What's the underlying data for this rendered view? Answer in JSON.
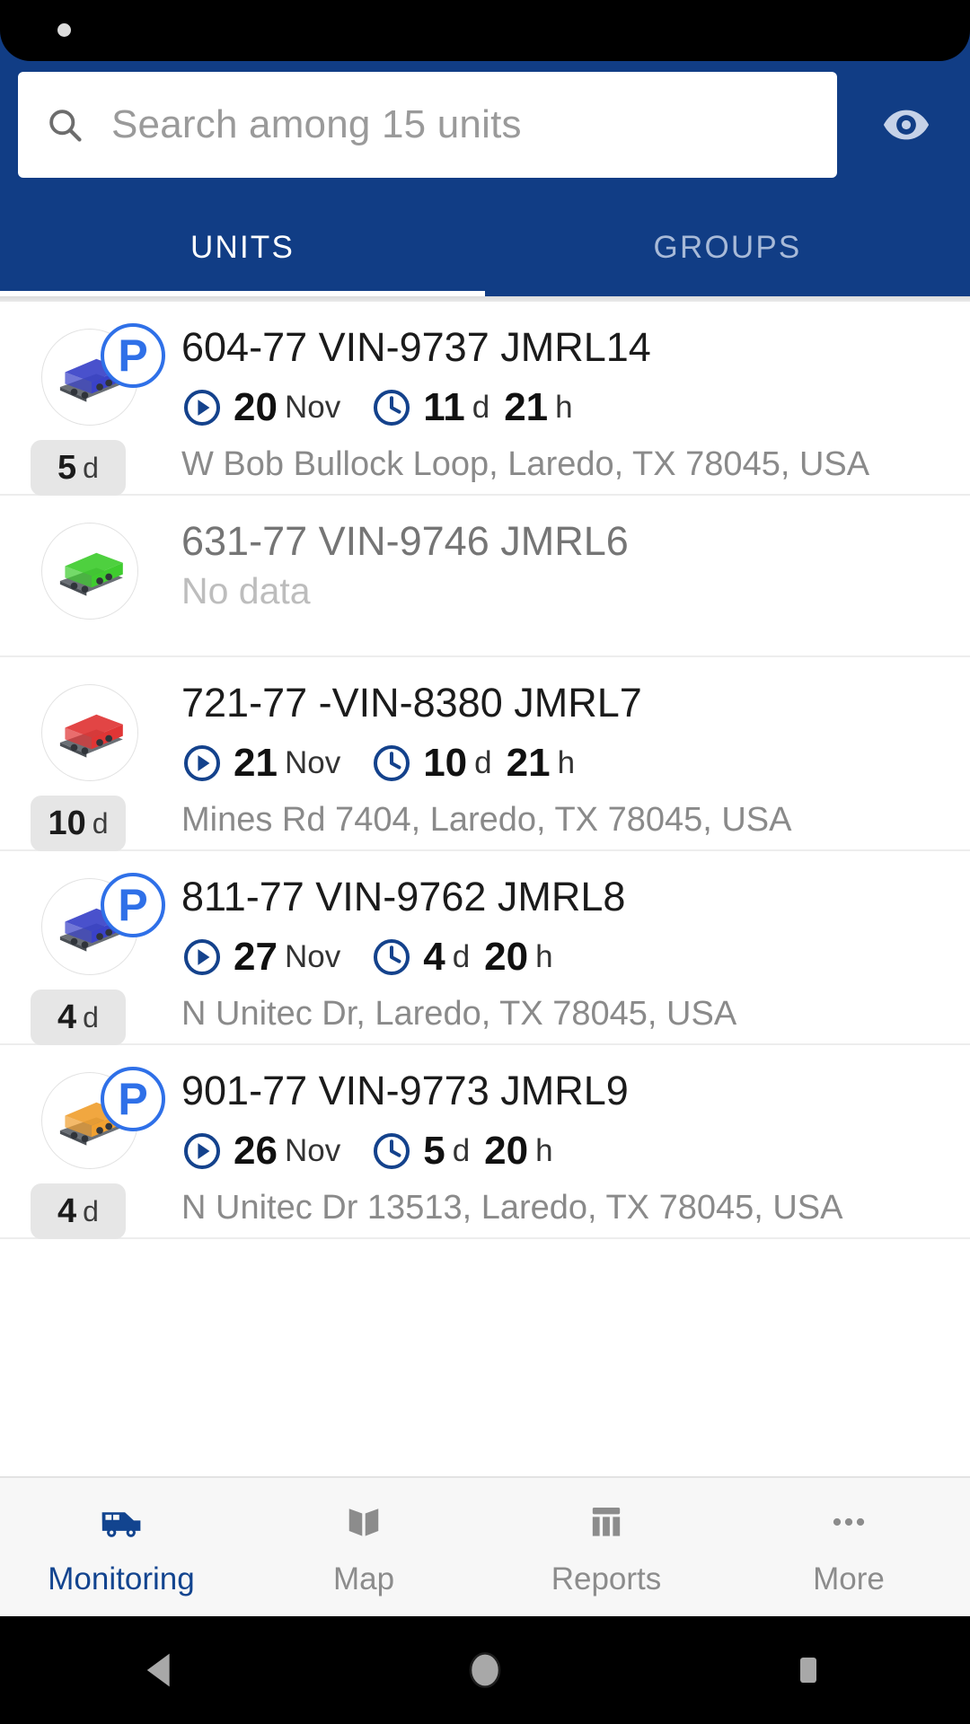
{
  "app": {
    "accent_blue": "#113d85",
    "badge_blue": "#2f70e8",
    "icon_blue": "#14428c"
  },
  "search": {
    "placeholder": "Search among 15 units",
    "value": "",
    "icon": "search-icon",
    "eye_icon": "eye-icon"
  },
  "tabs": [
    {
      "label": "UNITS",
      "active": true
    },
    {
      "label": "GROUPS",
      "active": false
    }
  ],
  "units": [
    {
      "title": "604-77 VIN-9737 JMRL14",
      "vehicle_color": "#3a42c8",
      "parked": true,
      "no_data": false,
      "date_value": "20",
      "date_unit": "Nov",
      "dur_days_value": "11",
      "dur_days_unit": "d",
      "dur_hours_value": "21",
      "dur_hours_unit": "h",
      "day_badge_num": "5",
      "day_badge_unit": "d",
      "address": "W Bob Bullock Loop, Laredo, TX 78045, USA"
    },
    {
      "title": "631-77 VIN-9746 JMRL6",
      "vehicle_color": "#3fcc2f",
      "parked": false,
      "no_data": true,
      "no_data_text": "No data"
    },
    {
      "title": "721-77 -VIN-8380 JMRL7",
      "vehicle_color": "#e03535",
      "parked": false,
      "no_data": false,
      "date_value": "21",
      "date_unit": "Nov",
      "dur_days_value": "10",
      "dur_days_unit": "d",
      "dur_hours_value": "21",
      "dur_hours_unit": "h",
      "day_badge_num": "10",
      "day_badge_unit": "d",
      "address": "Mines Rd 7404, Laredo, TX 78045, USA"
    },
    {
      "title": "811-77 VIN-9762 JMRL8",
      "vehicle_color": "#3a42c8",
      "parked": true,
      "no_data": false,
      "date_value": "27",
      "date_unit": "Nov",
      "dur_days_value": "4",
      "dur_days_unit": "d",
      "dur_hours_value": "20",
      "dur_hours_unit": "h",
      "day_badge_num": "4",
      "day_badge_unit": "d",
      "address": "N Unitec Dr, Laredo, TX 78045, USA"
    },
    {
      "title": "901-77 VIN-9773 JMRL9",
      "vehicle_color": "#f0a030",
      "parked": true,
      "no_data": false,
      "date_value": "26",
      "date_unit": "Nov",
      "dur_days_value": "5",
      "dur_days_unit": "d",
      "dur_hours_value": "20",
      "dur_hours_unit": "h",
      "day_badge_num": "4",
      "day_badge_unit": "d",
      "address": "N Unitec Dr 13513, Laredo, TX 78045, USA"
    }
  ],
  "bottom_nav": [
    {
      "label": "Monitoring",
      "icon": "van-icon",
      "active": true
    },
    {
      "label": "Map",
      "icon": "map-icon",
      "active": false
    },
    {
      "label": "Reports",
      "icon": "bar-chart-icon",
      "active": false
    },
    {
      "label": "More",
      "icon": "more-dots-icon",
      "active": false
    }
  ],
  "android_nav": [
    {
      "icon": "back-triangle-icon"
    },
    {
      "icon": "home-circle-icon"
    },
    {
      "icon": "recents-square-icon"
    }
  ]
}
